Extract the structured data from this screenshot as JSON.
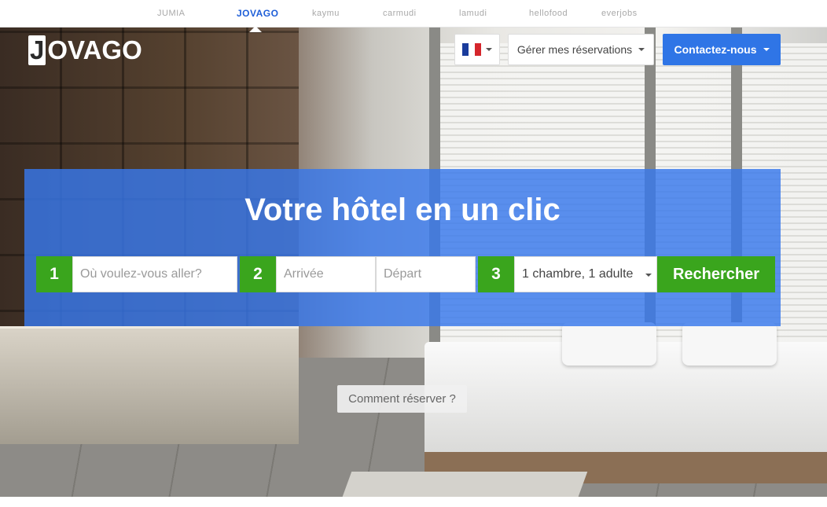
{
  "partners": [
    {
      "label": "JUMIA",
      "active": false
    },
    {
      "label": "JOVAGO",
      "active": true
    },
    {
      "label": "kaymu",
      "active": false
    },
    {
      "label": "carmudi",
      "active": false
    },
    {
      "label": "lamudi",
      "active": false
    },
    {
      "label": "hellofood",
      "active": false
    },
    {
      "label": "everjobs",
      "active": false
    }
  ],
  "logo": {
    "initial": "J",
    "rest": "OVAGO"
  },
  "header": {
    "language_flag": "france-flag",
    "manage_label": "Gérer mes réservations",
    "contact_label": "Contactez-nous"
  },
  "search": {
    "headline": "Votre hôtel en un clic",
    "step1": "1",
    "step2": "2",
    "step3": "3",
    "destination_placeholder": "Où voulez-vous aller?",
    "checkin_placeholder": "Arrivée",
    "checkout_placeholder": "Départ",
    "rooms_value": "1 chambre, 1 adulte",
    "submit_label": "Rechercher"
  },
  "how_to_label": "Comment réserver ?",
  "colors": {
    "accent_blue": "#2f75e6",
    "accent_green": "#3aa51d"
  }
}
